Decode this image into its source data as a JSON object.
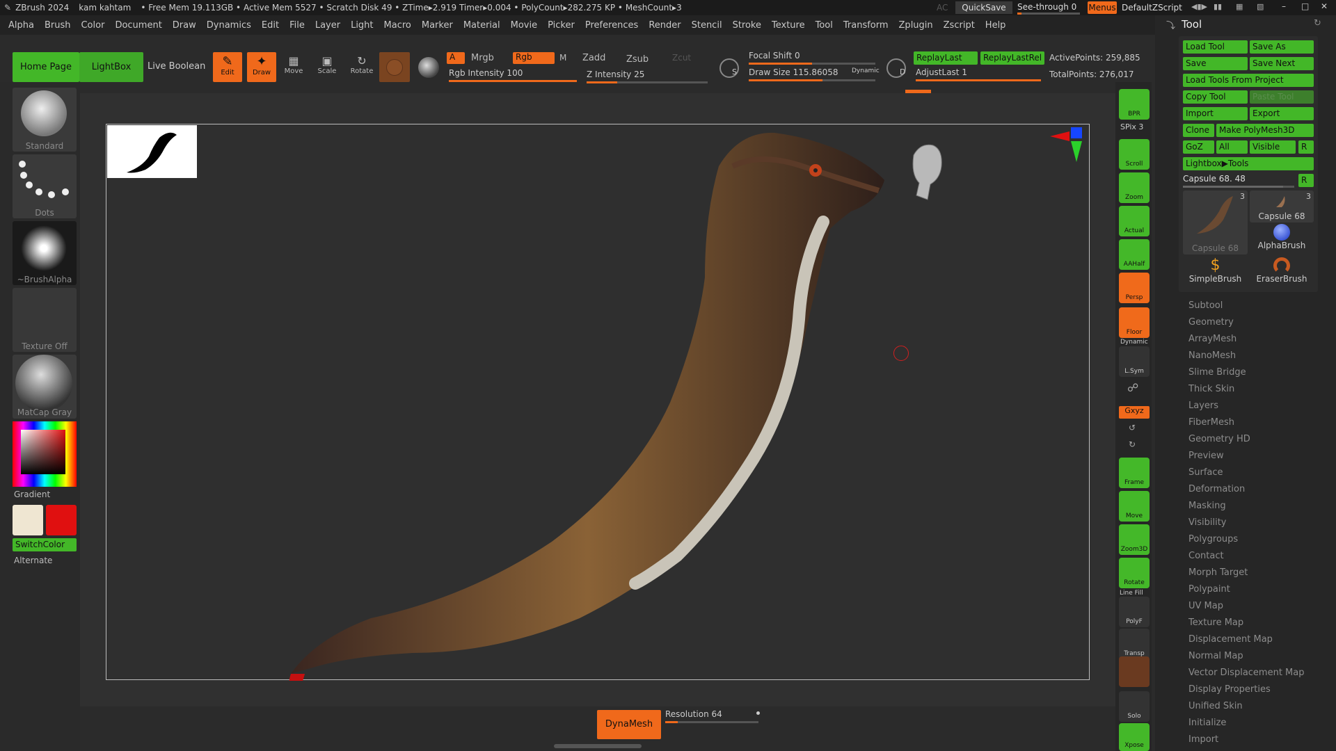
{
  "titlebar": {
    "app": "ZBrush 2024",
    "user": "kam kahtam",
    "stats": "• Free Mem 19.113GB • Active Mem 5527 • Scratch Disk 49 • ZTime▸2.919 Timer▸0.004 • PolyCount▸282.275 KP • MeshCount▸3",
    "ac": "AC",
    "quicksave": "QuickSave",
    "seethrough": "See-through 0",
    "menus": "Menus",
    "defaultzscript": "DefaultZScript"
  },
  "menu": [
    "Alpha",
    "Brush",
    "Color",
    "Document",
    "Draw",
    "Dynamics",
    "Edit",
    "File",
    "Layer",
    "Light",
    "Macro",
    "Marker",
    "Material",
    "Movie",
    "Picker",
    "Preferences",
    "Render",
    "Stencil",
    "Stroke",
    "Texture",
    "Tool",
    "Transform",
    "Zplugin",
    "Zscript",
    "Help"
  ],
  "toolbar": {
    "home": "Home Page",
    "lightbox": "LightBox",
    "liveboolean": "Live Boolean",
    "edit": "Edit",
    "draw": "Draw",
    "move": "Move",
    "scale": "Scale",
    "rotate": "Rotate",
    "a": "A",
    "mrgb": "Mrgb",
    "rgb": "Rgb",
    "m": "M",
    "zadd": "Zadd",
    "zsub": "Zsub",
    "zcut": "Zcut",
    "rgbintensity": "Rgb Intensity 100",
    "zintensity": "Z Intensity 25",
    "focalshift": "Focal Shift 0",
    "drawsize": "Draw Size 115.86058",
    "dynamic": "Dynamic",
    "s": "S",
    "d": "D",
    "replaylast": "ReplayLast",
    "replaylastrel": "ReplayLastRel",
    "adjustlast": "AdjustLast 1",
    "activepoints": "ActivePoints: 259,885",
    "totalpoints": "TotalPoints: 276,017"
  },
  "slider_levels": {
    "rgb_intensity": 1.0,
    "z_intensity": 0.25,
    "focal_shift": 0.5,
    "draw_size": 0.58,
    "adjust_last": 1.0
  },
  "left": {
    "standard": "Standard",
    "dots": "Dots",
    "brushalpha": "~BrushAlpha",
    "textureoff": "Texture Off",
    "matcap": "MatCap Gray",
    "gradient": "Gradient",
    "switchcolor": "SwitchColor",
    "alternate": "Alternate"
  },
  "colors": {
    "primary_swatch": "#efe6d2",
    "secondary_swatch": "#e01010",
    "accent_green": "#43b728",
    "accent_orange": "#f0691b"
  },
  "rightshelf": {
    "bpr": "BPR",
    "spix": "SPix 3",
    "scroll": "Scroll",
    "zoom": "Zoom",
    "actual": "Actual",
    "aahalf": "AAHalf",
    "dynamic": "Dynamic",
    "persp": "Persp",
    "floor": "Floor",
    "lsym": "L.Sym",
    "xyz": "Gxyz",
    "frame": "Frame",
    "move": "Move",
    "zoom3d": "Zoom3D",
    "rotate": "Rotate",
    "linefill": "Line Fill",
    "polyf": "PolyF",
    "transp": "Transp",
    "solo": "Solo",
    "xpose": "Xpose"
  },
  "tool": {
    "title": "Tool",
    "loadtool": "Load Tool",
    "saveas": "Save As",
    "save": "Save",
    "savenext": "Save Next",
    "loadproject": "Load Tools From Project",
    "copytool": "Copy Tool",
    "pastetool": "Paste Tool",
    "import": "Import",
    "export": "Export",
    "clone": "Clone",
    "makepolymesh": "Make PolyMesh3D",
    "goz": "GoZ",
    "all": "All",
    "visible": "Visible",
    "r": "R",
    "lightboxtools": "Lightbox▶Tools",
    "capsule": "Capsule 68. 48",
    "tiles": [
      {
        "name": "Capsule 68",
        "count": "3"
      },
      {
        "name": "Capsule 68",
        "count": "3"
      },
      {
        "name": "AlphaBrush"
      },
      {
        "name": "SimpleBrush"
      },
      {
        "name": "EraserBrush"
      }
    ],
    "subpalettes": [
      "Subtool",
      "Geometry",
      "ArrayMesh",
      "NanoMesh",
      "Slime Bridge",
      "Thick Skin",
      "Layers",
      "FiberMesh",
      "Geometry HD",
      "Preview",
      "Surface",
      "Deformation",
      "Masking",
      "Visibility",
      "Polygroups",
      "Contact",
      "Morph Target",
      "Polypaint",
      "UV Map",
      "Texture Map",
      "Displacement Map",
      "Normal Map",
      "Vector Displacement Map",
      "Display Properties",
      "Unified Skin",
      "Initialize",
      "Import"
    ]
  },
  "bottom": {
    "dynamesh": "DynaMesh",
    "resolution": "Resolution 64"
  }
}
